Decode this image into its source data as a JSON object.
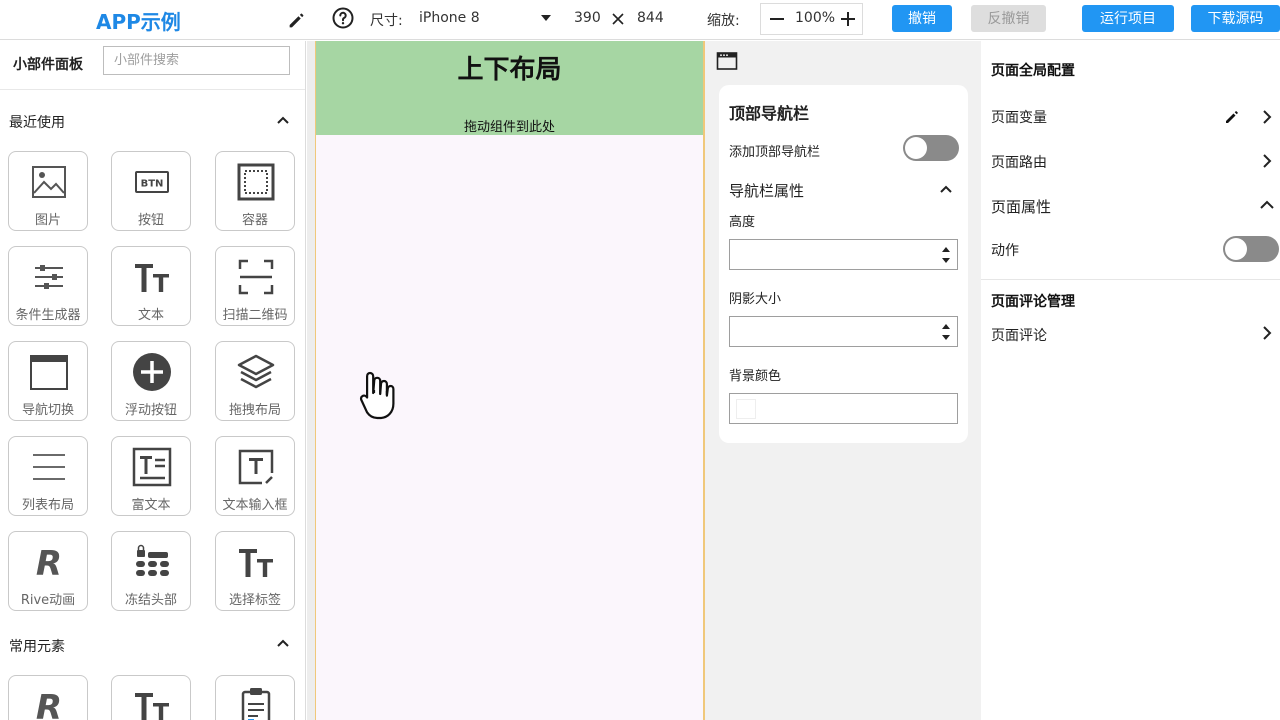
{
  "topbar": {
    "app_title": "APP示例",
    "size_label": "尺寸:",
    "device": "iPhone 8",
    "width": "390",
    "height": "844",
    "zoom_label": "缩放:",
    "zoom_value": "100%",
    "undo": "撤销",
    "redo": "反撤销",
    "run": "运行项目",
    "download": "下载源码"
  },
  "left_panel": {
    "title": "小部件面板",
    "search_placeholder": "小部件搜索",
    "recent_heading": "最近使用",
    "common_heading": "常用元素",
    "recent_widgets": [
      {
        "label": "图片",
        "icon": "image-icon"
      },
      {
        "label": "按钮",
        "icon": "btn-icon"
      },
      {
        "label": "容器",
        "icon": "container-icon"
      },
      {
        "label": "条件生成器",
        "icon": "sliders-icon"
      },
      {
        "label": "文本",
        "icon": "text-icon"
      },
      {
        "label": "扫描二维码",
        "icon": "scan-icon"
      },
      {
        "label": "导航切换",
        "icon": "window-icon"
      },
      {
        "label": "浮动按钮",
        "icon": "add-circle-icon"
      },
      {
        "label": "拖拽布局",
        "icon": "layers-icon"
      },
      {
        "label": "列表布局",
        "icon": "menu-lines-icon"
      },
      {
        "label": "富文本",
        "icon": "rich-text-icon"
      },
      {
        "label": "文本输入框",
        "icon": "text-field-icon"
      },
      {
        "label": "Rive动画",
        "icon": "rive-icon"
      },
      {
        "label": "冻结头部",
        "icon": "lock-grid-icon"
      },
      {
        "label": "选择标签",
        "icon": "text-icon"
      }
    ]
  },
  "canvas": {
    "title": "上下布局",
    "drop_hint": "拖动组件到此处"
  },
  "navbar_panel": {
    "title": "顶部导航栏",
    "add_toggle_label": "添加顶部导航栏",
    "add_toggle_on": false,
    "props_heading": "导航栏属性",
    "height_label": "高度",
    "height_value": "",
    "shadow_label": "阴影大小",
    "shadow_value": "",
    "bg_color_label": "背景颜色",
    "bg_color_value": ""
  },
  "right_panel": {
    "global_heading": "页面全局配置",
    "variables": "页面变量",
    "routes": "页面路由",
    "properties": "页面属性",
    "action_label": "动作",
    "action_on": false,
    "comments_heading": "页面评论管理",
    "comments": "页面评论"
  },
  "colors": {
    "accent": "#2196f3",
    "canvas_header": "#a6d6a3",
    "canvas_border": "#f0c87a",
    "disabled": "#dedede"
  }
}
